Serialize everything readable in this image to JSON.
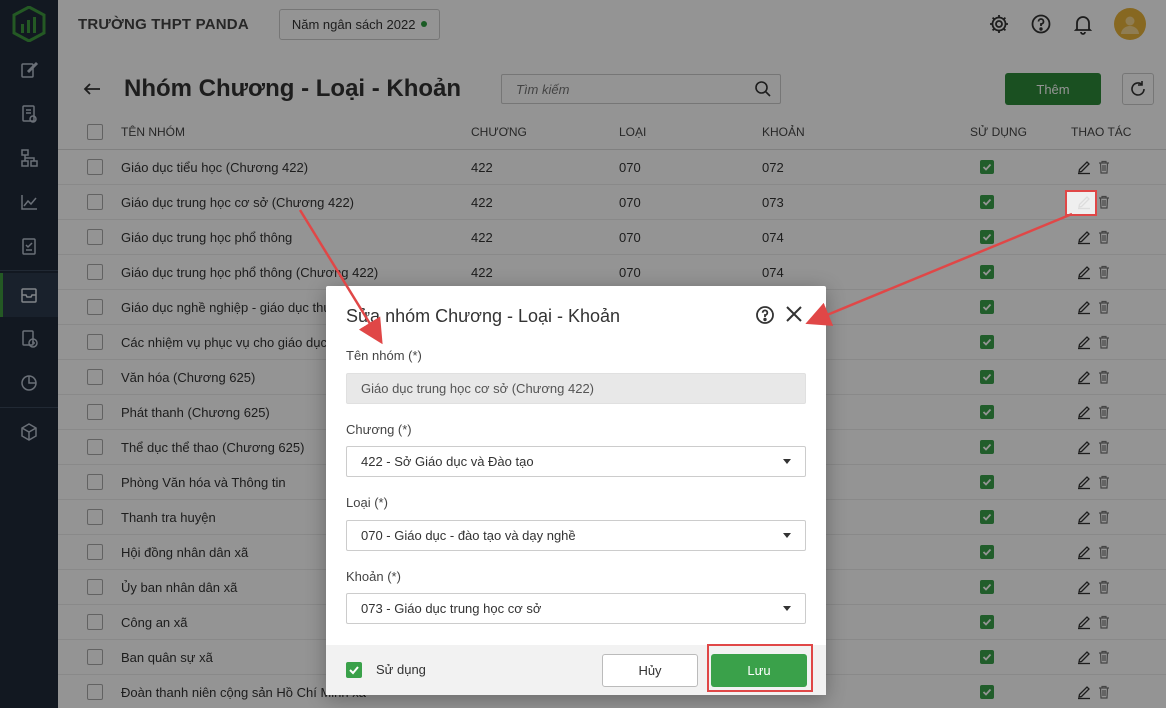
{
  "header": {
    "school": "TRƯỜNG THPT PANDA",
    "budget_year": "Năm ngân sách 2022"
  },
  "page": {
    "title": "Nhóm Chương - Loại - Khoản",
    "search_placeholder": "Tìm kiếm",
    "add_label": "Thêm"
  },
  "table": {
    "columns": {
      "name": "TÊN NHÓM",
      "chuong": "CHƯƠNG",
      "loai": "LOẠI",
      "khoan": "KHOẢN",
      "su_dung": "SỬ DỤNG",
      "thao_tac": "THAO TÁC"
    },
    "rows": [
      {
        "name": "Giáo dục tiểu học (Chương 422)",
        "chuong": "422",
        "loai": "070",
        "khoan": "072"
      },
      {
        "name": "Giáo dục trung học cơ sở (Chương 422)",
        "chuong": "422",
        "loai": "070",
        "khoan": "073"
      },
      {
        "name": "Giáo dục trung học phổ thông",
        "chuong": "422",
        "loai": "070",
        "khoan": "074"
      },
      {
        "name": "Giáo dục trung học phổ thông (Chương 422)",
        "chuong": "422",
        "loai": "070",
        "khoan": "074"
      },
      {
        "name": "Giáo dục nghề nghiệp - giáo dục thư",
        "chuong": "",
        "loai": "",
        "khoan": ""
      },
      {
        "name": "Các nhiệm vụ phục vụ cho giáo dục,",
        "chuong": "",
        "loai": "",
        "khoan": ""
      },
      {
        "name": "Văn hóa (Chương 625)",
        "chuong": "",
        "loai": "",
        "khoan": ""
      },
      {
        "name": "Phát thanh (Chương 625)",
        "chuong": "",
        "loai": "",
        "khoan": ""
      },
      {
        "name": "Thể dục thể thao (Chương 625)",
        "chuong": "",
        "loai": "",
        "khoan": ""
      },
      {
        "name": "Phòng Văn hóa và Thông tin",
        "chuong": "",
        "loai": "",
        "khoan": ""
      },
      {
        "name": "Thanh tra huyện",
        "chuong": "",
        "loai": "",
        "khoan": ""
      },
      {
        "name": "Hội đồng nhân dân xã",
        "chuong": "",
        "loai": "",
        "khoan": ""
      },
      {
        "name": "Ủy ban nhân dân xã",
        "chuong": "",
        "loai": "",
        "khoan": ""
      },
      {
        "name": "Công an xã",
        "chuong": "",
        "loai": "",
        "khoan": ""
      },
      {
        "name": "Ban quân sự xã",
        "chuong": "",
        "loai": "",
        "khoan": ""
      },
      {
        "name": "Đoàn thanh niên cộng sản Hồ Chí Minh xã",
        "chuong": "",
        "loai": "",
        "khoan": ""
      }
    ]
  },
  "dialog": {
    "title": "Sửa nhóm Chương - Loại - Khoản",
    "name_label": "Tên nhóm (*)",
    "name_value": "Giáo dục trung học cơ sở (Chương 422)",
    "chuong_label": "Chương (*)",
    "chuong_value": "422 - Sở Giáo dục và Đào tạo",
    "loai_label": "Loại (*)",
    "loai_value": "070 - Giáo dục - đào tạo và dạy nghề",
    "khoan_label": "Khoản (*)",
    "khoan_value": "073 - Giáo dục trung học cơ sở",
    "su_dung_label": "Sử dụng",
    "cancel_label": "Hủy",
    "save_label": "Lưu"
  },
  "colors": {
    "sidebar": "#1f2a3a",
    "accent_green": "#2e8b3a",
    "highlight_red": "#e04747"
  }
}
